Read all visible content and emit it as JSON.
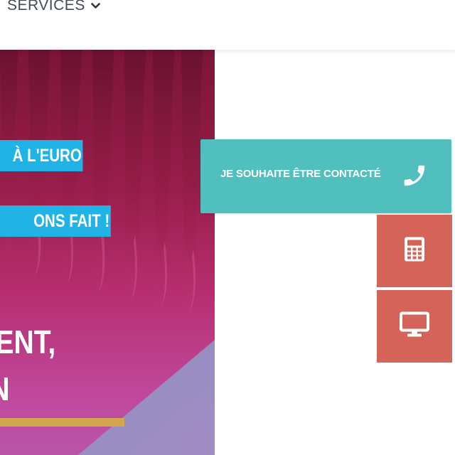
{
  "nav": {
    "services_label": "SERVICES"
  },
  "hero": {
    "tag_1": "À L'EURO",
    "tag_2": "ONS FAIT !",
    "heading_line_1": "ENT,",
    "heading_line_2": "N"
  },
  "floating": {
    "contact_label": "JE SOUHAITE ÊTRE CONTACTÉ",
    "contact_icon": "phone-icon",
    "calculator_icon": "calculator-icon",
    "screen_icon": "monitor-icon"
  },
  "colors": {
    "contact_button": "#52bfbf",
    "side_buttons": "#d4645a",
    "hero_tag": "#1fb3e6",
    "hero_accent_line": "#d4a74f"
  }
}
